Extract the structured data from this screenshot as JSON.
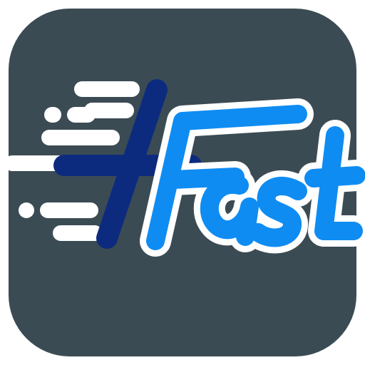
{
  "icon": {
    "logo_text": "+Fast",
    "colors": {
      "background": "#3b4b54",
      "outline": "#ffffff",
      "plus": "#0d2b7e",
      "letters": "#0f8cf2",
      "speed_lines": "#ffffff"
    },
    "decor": [
      "speed-lines",
      "plus-sign-icon"
    ]
  }
}
